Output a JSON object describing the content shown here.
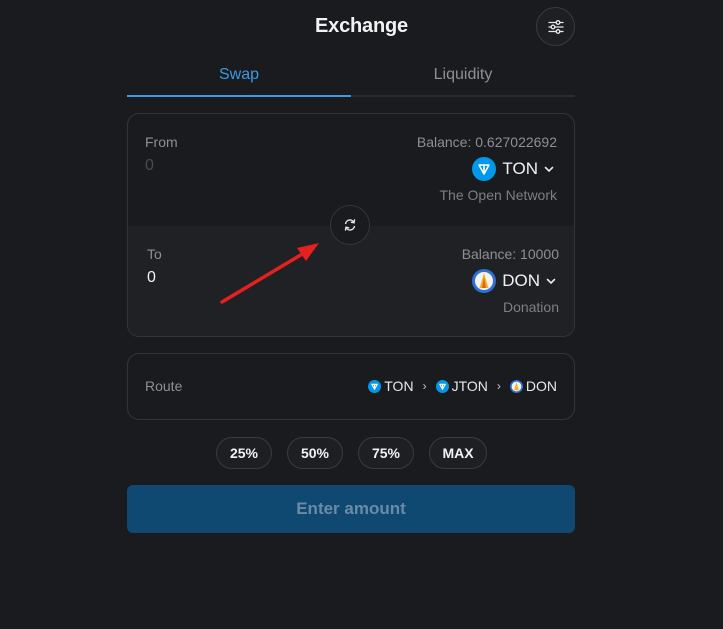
{
  "header": {
    "title": "Exchange",
    "settings_icon": "sliders-icon"
  },
  "tabs": [
    {
      "label": "Swap",
      "active": true
    },
    {
      "label": "Liquidity",
      "active": false
    }
  ],
  "from": {
    "label": "From",
    "amount_placeholder": "0",
    "balance": "Balance: 0.627022692",
    "token": "TON",
    "token_fullname": "The Open Network",
    "token_icon": "ton-icon"
  },
  "to": {
    "label": "To",
    "amount": "0",
    "balance": "Balance: 10000",
    "token": "DON",
    "token_fullname": "Donation",
    "token_icon": "don-icon"
  },
  "route": {
    "label": "Route",
    "steps": [
      "TON",
      "JTON",
      "DON"
    ]
  },
  "percent_buttons": [
    "25%",
    "50%",
    "75%",
    "MAX"
  ],
  "submit": {
    "label": "Enter amount"
  },
  "colors": {
    "accent": "#3a9ae6",
    "background": "#1a1b1e",
    "button": "#0f4870",
    "annotation_arrow": "#e5201e"
  }
}
